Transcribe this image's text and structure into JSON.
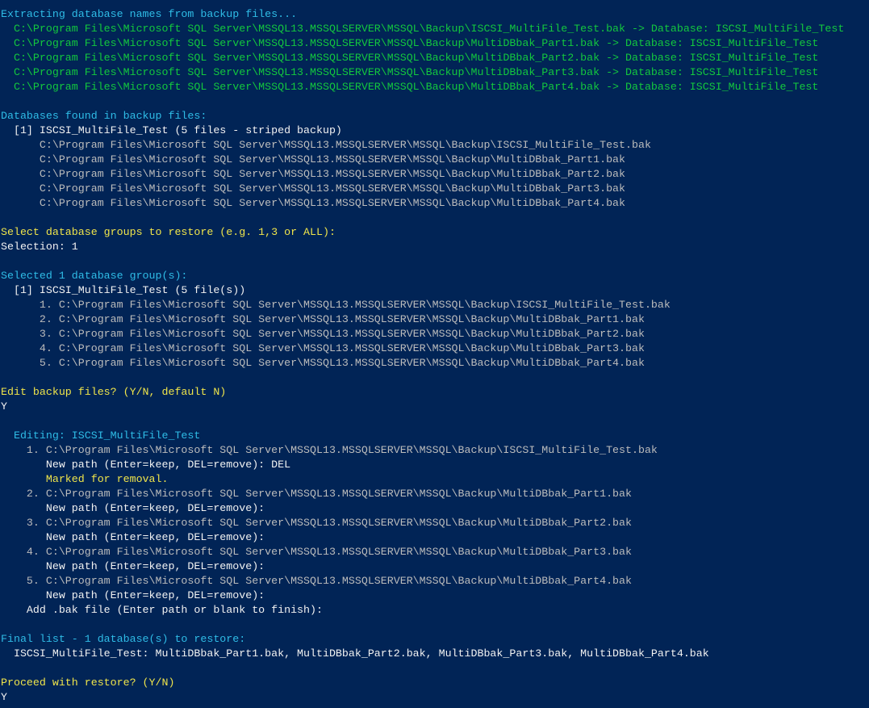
{
  "colors": {
    "background": "#012456",
    "cyan": "#2fbce6",
    "green": "#13c83e",
    "yellow": "#f0e54a",
    "gray": "#bcbcbc",
    "white": "#f2f2f2"
  },
  "lines": [
    {
      "text": "Extracting database names from backup files...",
      "color": "cyan"
    },
    {
      "text": "  C:\\Program Files\\Microsoft SQL Server\\MSSQL13.MSSQLSERVER\\MSSQL\\Backup\\ISCSI_MultiFile_Test.bak -> Database: ISCSI_MultiFile_Test",
      "color": "green"
    },
    {
      "text": "  C:\\Program Files\\Microsoft SQL Server\\MSSQL13.MSSQLSERVER\\MSSQL\\Backup\\MultiDBbak_Part1.bak -> Database: ISCSI_MultiFile_Test",
      "color": "green"
    },
    {
      "text": "  C:\\Program Files\\Microsoft SQL Server\\MSSQL13.MSSQLSERVER\\MSSQL\\Backup\\MultiDBbak_Part2.bak -> Database: ISCSI_MultiFile_Test",
      "color": "green"
    },
    {
      "text": "  C:\\Program Files\\Microsoft SQL Server\\MSSQL13.MSSQLSERVER\\MSSQL\\Backup\\MultiDBbak_Part3.bak -> Database: ISCSI_MultiFile_Test",
      "color": "green"
    },
    {
      "text": "  C:\\Program Files\\Microsoft SQL Server\\MSSQL13.MSSQLSERVER\\MSSQL\\Backup\\MultiDBbak_Part4.bak -> Database: ISCSI_MultiFile_Test",
      "color": "green"
    },
    {
      "text": "",
      "color": "white"
    },
    {
      "text": "Databases found in backup files:",
      "color": "cyan"
    },
    {
      "text": "  [1] ISCSI_MultiFile_Test (5 files - striped backup)",
      "color": "white"
    },
    {
      "text": "      C:\\Program Files\\Microsoft SQL Server\\MSSQL13.MSSQLSERVER\\MSSQL\\Backup\\ISCSI_MultiFile_Test.bak",
      "color": "gray"
    },
    {
      "text": "      C:\\Program Files\\Microsoft SQL Server\\MSSQL13.MSSQLSERVER\\MSSQL\\Backup\\MultiDBbak_Part1.bak",
      "color": "gray"
    },
    {
      "text": "      C:\\Program Files\\Microsoft SQL Server\\MSSQL13.MSSQLSERVER\\MSSQL\\Backup\\MultiDBbak_Part2.bak",
      "color": "gray"
    },
    {
      "text": "      C:\\Program Files\\Microsoft SQL Server\\MSSQL13.MSSQLSERVER\\MSSQL\\Backup\\MultiDBbak_Part3.bak",
      "color": "gray"
    },
    {
      "text": "      C:\\Program Files\\Microsoft SQL Server\\MSSQL13.MSSQLSERVER\\MSSQL\\Backup\\MultiDBbak_Part4.bak",
      "color": "gray"
    },
    {
      "text": "",
      "color": "white"
    },
    {
      "text": "Select database groups to restore (e.g. 1,3 or ALL):",
      "color": "yellow"
    },
    {
      "text": "Selection: 1",
      "color": "white"
    },
    {
      "text": "",
      "color": "white"
    },
    {
      "text": "Selected 1 database group(s):",
      "color": "cyan"
    },
    {
      "text": "  [1] ISCSI_MultiFile_Test (5 file(s))",
      "color": "white"
    },
    {
      "text": "      1. C:\\Program Files\\Microsoft SQL Server\\MSSQL13.MSSQLSERVER\\MSSQL\\Backup\\ISCSI_MultiFile_Test.bak",
      "color": "gray"
    },
    {
      "text": "      2. C:\\Program Files\\Microsoft SQL Server\\MSSQL13.MSSQLSERVER\\MSSQL\\Backup\\MultiDBbak_Part1.bak",
      "color": "gray"
    },
    {
      "text": "      3. C:\\Program Files\\Microsoft SQL Server\\MSSQL13.MSSQLSERVER\\MSSQL\\Backup\\MultiDBbak_Part2.bak",
      "color": "gray"
    },
    {
      "text": "      4. C:\\Program Files\\Microsoft SQL Server\\MSSQL13.MSSQLSERVER\\MSSQL\\Backup\\MultiDBbak_Part3.bak",
      "color": "gray"
    },
    {
      "text": "      5. C:\\Program Files\\Microsoft SQL Server\\MSSQL13.MSSQLSERVER\\MSSQL\\Backup\\MultiDBbak_Part4.bak",
      "color": "gray"
    },
    {
      "text": "",
      "color": "white"
    },
    {
      "text": "Edit backup files? (Y/N, default N)",
      "color": "yellow"
    },
    {
      "text": "Y",
      "color": "white"
    },
    {
      "text": "",
      "color": "white"
    },
    {
      "text": "  Editing: ISCSI_MultiFile_Test",
      "color": "cyan"
    },
    {
      "text": "    1. C:\\Program Files\\Microsoft SQL Server\\MSSQL13.MSSQLSERVER\\MSSQL\\Backup\\ISCSI_MultiFile_Test.bak",
      "color": "gray"
    },
    {
      "text": "       New path (Enter=keep, DEL=remove): DEL",
      "color": "white"
    },
    {
      "text": "       Marked for removal.",
      "color": "yellow"
    },
    {
      "text": "    2. C:\\Program Files\\Microsoft SQL Server\\MSSQL13.MSSQLSERVER\\MSSQL\\Backup\\MultiDBbak_Part1.bak",
      "color": "gray"
    },
    {
      "text": "       New path (Enter=keep, DEL=remove):",
      "color": "white"
    },
    {
      "text": "    3. C:\\Program Files\\Microsoft SQL Server\\MSSQL13.MSSQLSERVER\\MSSQL\\Backup\\MultiDBbak_Part2.bak",
      "color": "gray"
    },
    {
      "text": "       New path (Enter=keep, DEL=remove):",
      "color": "white"
    },
    {
      "text": "    4. C:\\Program Files\\Microsoft SQL Server\\MSSQL13.MSSQLSERVER\\MSSQL\\Backup\\MultiDBbak_Part3.bak",
      "color": "gray"
    },
    {
      "text": "       New path (Enter=keep, DEL=remove):",
      "color": "white"
    },
    {
      "text": "    5. C:\\Program Files\\Microsoft SQL Server\\MSSQL13.MSSQLSERVER\\MSSQL\\Backup\\MultiDBbak_Part4.bak",
      "color": "gray"
    },
    {
      "text": "       New path (Enter=keep, DEL=remove):",
      "color": "white"
    },
    {
      "text": "    Add .bak file (Enter path or blank to finish):",
      "color": "white"
    },
    {
      "text": "",
      "color": "white"
    },
    {
      "text": "Final list - 1 database(s) to restore:",
      "color": "cyan"
    },
    {
      "text": "  ISCSI_MultiFile_Test: MultiDBbak_Part1.bak, MultiDBbak_Part2.bak, MultiDBbak_Part3.bak, MultiDBbak_Part4.bak",
      "color": "white"
    },
    {
      "text": "",
      "color": "white"
    },
    {
      "text": "Proceed with restore? (Y/N)",
      "color": "yellow"
    },
    {
      "text": "Y",
      "color": "white"
    }
  ]
}
